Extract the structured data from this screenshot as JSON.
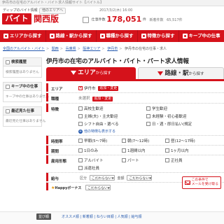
{
  "topstrip": "伊丹市の在宅のアルバイト・バイト求人情報サイト【バイトル】",
  "header": {
    "tagline": "ディップのバイト情報",
    "logo": "バイトル",
    "region": "関西版",
    "region_select": "他のエリアへ",
    "date": "2017/3/2(木) 16:00",
    "jobs_label": "仕事件数",
    "jobs_count": "178,051",
    "jobs_unit": "件",
    "new_label": "新着件数",
    "new_count": "65,517件"
  },
  "nav": [
    "エリアから探す",
    "路線・駅から探す",
    "職種から探す",
    "特徴から探す",
    "キープ中の仕事"
  ],
  "breadcrumb": [
    "全国のアルバイト・バイト",
    "関西",
    "兵庫県",
    "阪神エリア",
    "伊丹市",
    "伊丹市の在宅の仕事・求人"
  ],
  "sidebar": {
    "history_title": "検索履歴",
    "history_empty": "検索履歴はありません",
    "keep_title": "キープ中の仕事",
    "keep_empty": "キープ中の仕事はありません",
    "recent_title": "最近見た仕事",
    "recent_empty": "最近見た仕事はありません"
  },
  "main": {
    "title": "伊丹市の在宅のアルバイト・バイト・パート求人情報",
    "tab_area": "エリア",
    "tab_area_suffix": "から探す",
    "tab_line": "路線・駅",
    "tab_line_suffix": "から探す"
  },
  "form": {
    "area_label": "エリア",
    "area_value": "伊丹市",
    "area_change": "追加・変更",
    "job_label": "職種",
    "job_value": "未選択",
    "job_change": "追加・変更",
    "feature_label": "特徴",
    "features": [
      "高校生歓迎",
      "学生歓迎",
      "主婦(夫)・主夫歓迎",
      "未経験・初心者歓迎",
      "シフト自由・選べる",
      "日・週・即日払い(規定"
    ],
    "more_features": "他の特徴も表示する",
    "hours_label": "時間帯",
    "hours": [
      "早朝(5〜7時)",
      "朝(7〜12時)",
      "昼(12〜17時)"
    ],
    "term_label": "期間",
    "terms": [
      "1日のみ",
      "1週間以内",
      "1ヶ月以内"
    ],
    "employ_label": "雇用形態",
    "employs": [
      "アルバイト",
      "パート",
      "正社員",
      "派遣社員"
    ],
    "wage_label": "給与",
    "wage_kubun": "区分",
    "wage_kubun_sel": "こだわらない",
    "wage_kingaku": "金額",
    "wage_kingaku_sel": "こだわらない",
    "happy_label": "Happyボーナス",
    "happy_sel": "こだわらない",
    "save_line1": "この条件で",
    "save_line2": "メールを受け取る"
  },
  "bottom": {
    "label": "並び順",
    "links": "オススメ順 | 新着順 | ねらい目順 | 人気順 | 給与順"
  }
}
